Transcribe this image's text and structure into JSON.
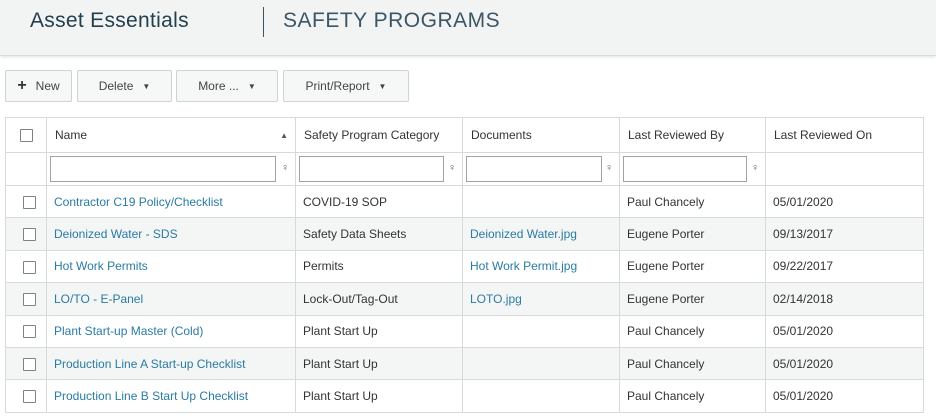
{
  "header": {
    "app_title": "Asset Essentials",
    "page_title": "SAFETY PROGRAMS"
  },
  "toolbar": {
    "new_label": "New",
    "delete_label": "Delete",
    "more_label": "More ...",
    "print_label": "Print/Report"
  },
  "grid": {
    "columns": [
      "Name",
      "Safety Program Category",
      "Documents",
      "Last Reviewed By",
      "Last Reviewed On"
    ],
    "sort": {
      "column": "Name",
      "direction": "ascending"
    },
    "filters": {
      "name": "",
      "category": "",
      "documents": "",
      "reviewed_by": ""
    },
    "rows": [
      {
        "name": "Contractor C19 Policy/Checklist",
        "category": "COVID-19 SOP",
        "document": "",
        "reviewed_by": "Paul Chancely",
        "reviewed_on": "05/01/2020"
      },
      {
        "name": "Deionized Water - SDS",
        "category": "Safety Data Sheets",
        "document": "Deionized Water.jpg",
        "reviewed_by": "Eugene Porter",
        "reviewed_on": "09/13/2017"
      },
      {
        "name": "Hot Work Permits",
        "category": "Permits",
        "document": "Hot Work Permit.jpg",
        "reviewed_by": "Eugene Porter",
        "reviewed_on": "09/22/2017"
      },
      {
        "name": "LO/TO - E-Panel",
        "category": "Lock-Out/Tag-Out",
        "document": "LOTO.jpg",
        "reviewed_by": "Eugene Porter",
        "reviewed_on": "02/14/2018"
      },
      {
        "name": "Plant Start-up Master (Cold)",
        "category": "Plant Start Up",
        "document": "",
        "reviewed_by": "Paul Chancely",
        "reviewed_on": "05/01/2020"
      },
      {
        "name": "Production Line A Start-up Checklist",
        "category": "Plant Start Up",
        "document": "",
        "reviewed_by": "Paul Chancely",
        "reviewed_on": "05/01/2020"
      },
      {
        "name": "Production Line B Start Up Checklist",
        "category": "Plant Start Up",
        "document": "",
        "reviewed_by": "Paul Chancely",
        "reviewed_on": "05/01/2020"
      }
    ]
  },
  "colors": {
    "link": "#2a7ba3",
    "header_bg": "#f2f3f3",
    "title": "#233f4e"
  },
  "icons": {
    "new": "plus-icon",
    "dropdown": "caret-down-icon",
    "filter": "filter-icon",
    "sort": "sort-asc-icon"
  }
}
